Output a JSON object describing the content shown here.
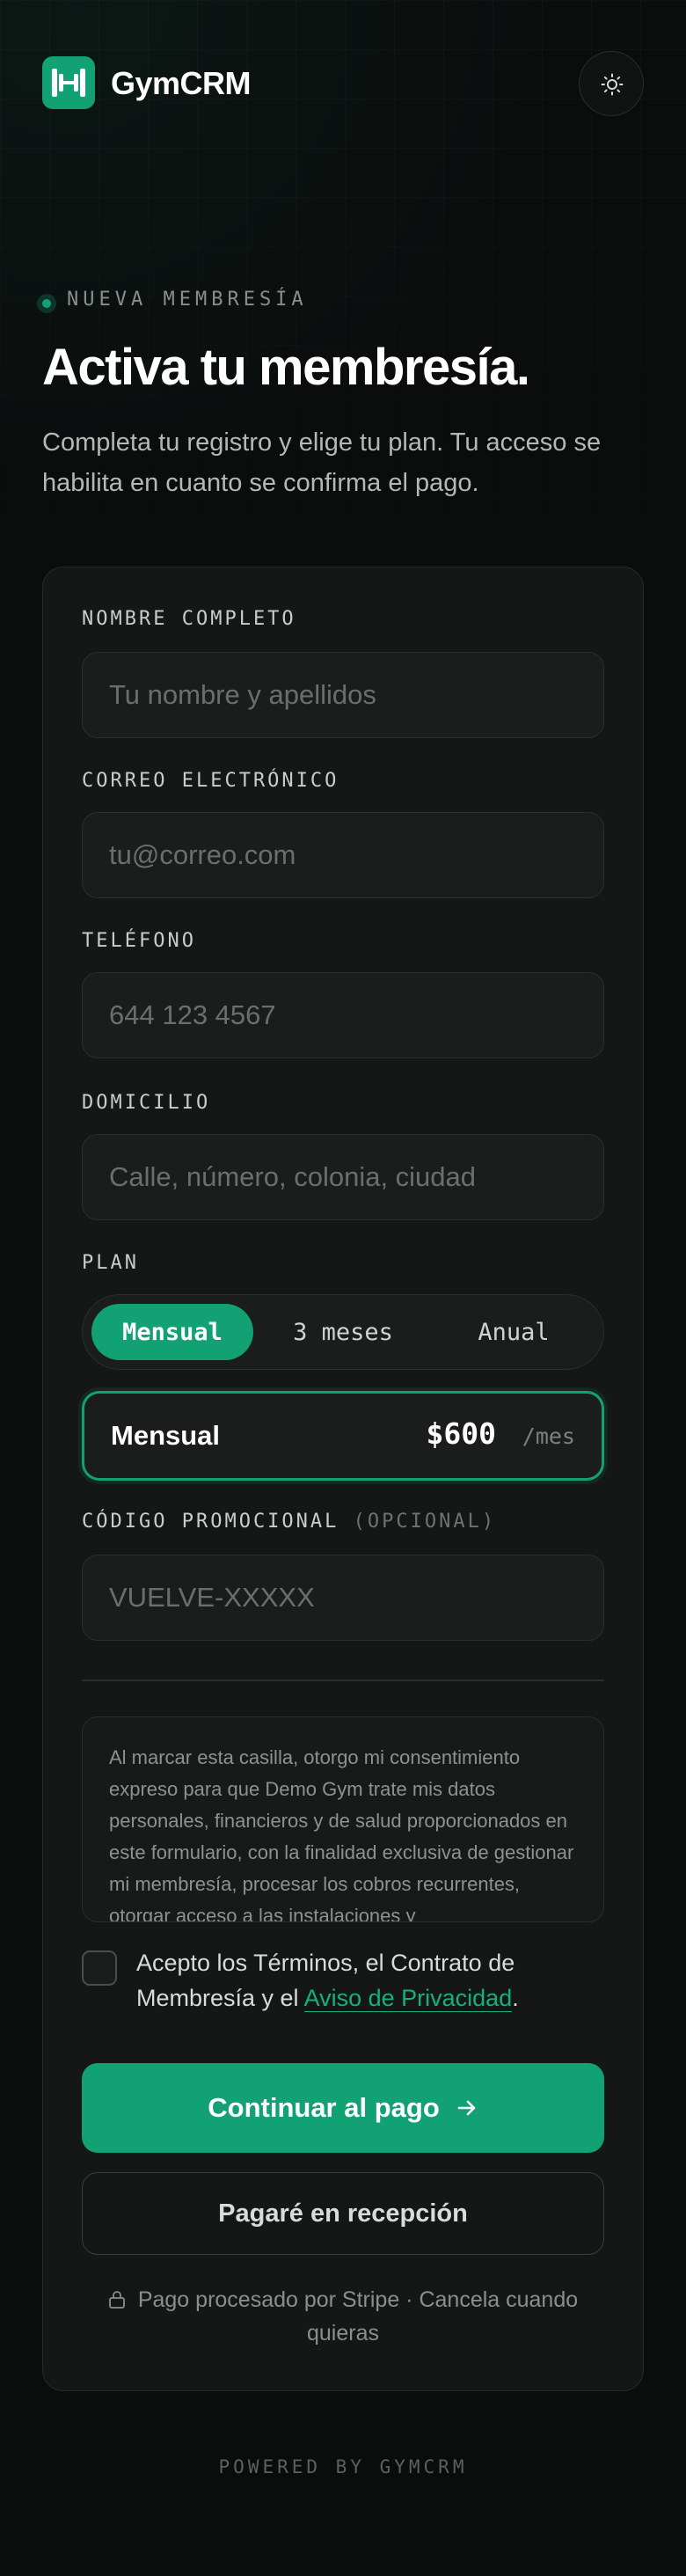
{
  "header": {
    "brand": "GymCRM",
    "theme_toggle_icon": "sun-icon",
    "logo_icon": "dumbbell-icon",
    "accent_color": "#12a173"
  },
  "hero": {
    "eyebrow": "NUEVA MEMBRESÍA",
    "title": "Activa tu membresía.",
    "subtitle": "Completa tu registro y elige tu plan. Tu acceso se habilita en cuanto se confirma el pago."
  },
  "form": {
    "name": {
      "label": "NOMBRE COMPLETO",
      "placeholder": "Tu nombre y apellidos",
      "value": ""
    },
    "email": {
      "label": "CORREO ELECTRÓNICO",
      "placeholder": "tu@correo.com",
      "value": ""
    },
    "phone": {
      "label": "TELÉFONO",
      "placeholder": "644 123 4567",
      "value": ""
    },
    "address": {
      "label": "DOMICILIO",
      "placeholder": "Calle, número, colonia, ciudad",
      "value": ""
    },
    "plan": {
      "label": "PLAN",
      "options": [
        "Mensual",
        "3 meses",
        "Anual"
      ],
      "selected": "Mensual",
      "summary": {
        "name": "Mensual",
        "price": "$600",
        "period": "/mes"
      }
    },
    "promo": {
      "label": "CÓDIGO PROMOCIONAL",
      "optional": "(OPCIONAL)",
      "placeholder": "VUELVE-XXXXX",
      "value": ""
    },
    "consent_text": "Al marcar esta casilla, otorgo mi consentimiento expreso para que Demo Gym trate mis datos personales, financieros y de salud proporcionados en este formulario, con la finalidad exclusiva de gestionar mi membresía, procesar los cobros recurrentes, otorgar acceso a las instalaciones y",
    "accept": {
      "checked": false,
      "text_before": "Acepto los Términos, el Contrato de Membresía y el ",
      "link": "Aviso de Privacidad",
      "text_after": "."
    },
    "primary_button": "Continuar al pago",
    "primary_button_icon": "arrow-right-icon",
    "secondary_button": "Pagaré en recepción",
    "secure_note": "Pago procesado por Stripe · Cancela cuando quieras",
    "secure_icon": "lock-icon"
  },
  "footer": {
    "text": "POWERED BY GYMCRM"
  }
}
